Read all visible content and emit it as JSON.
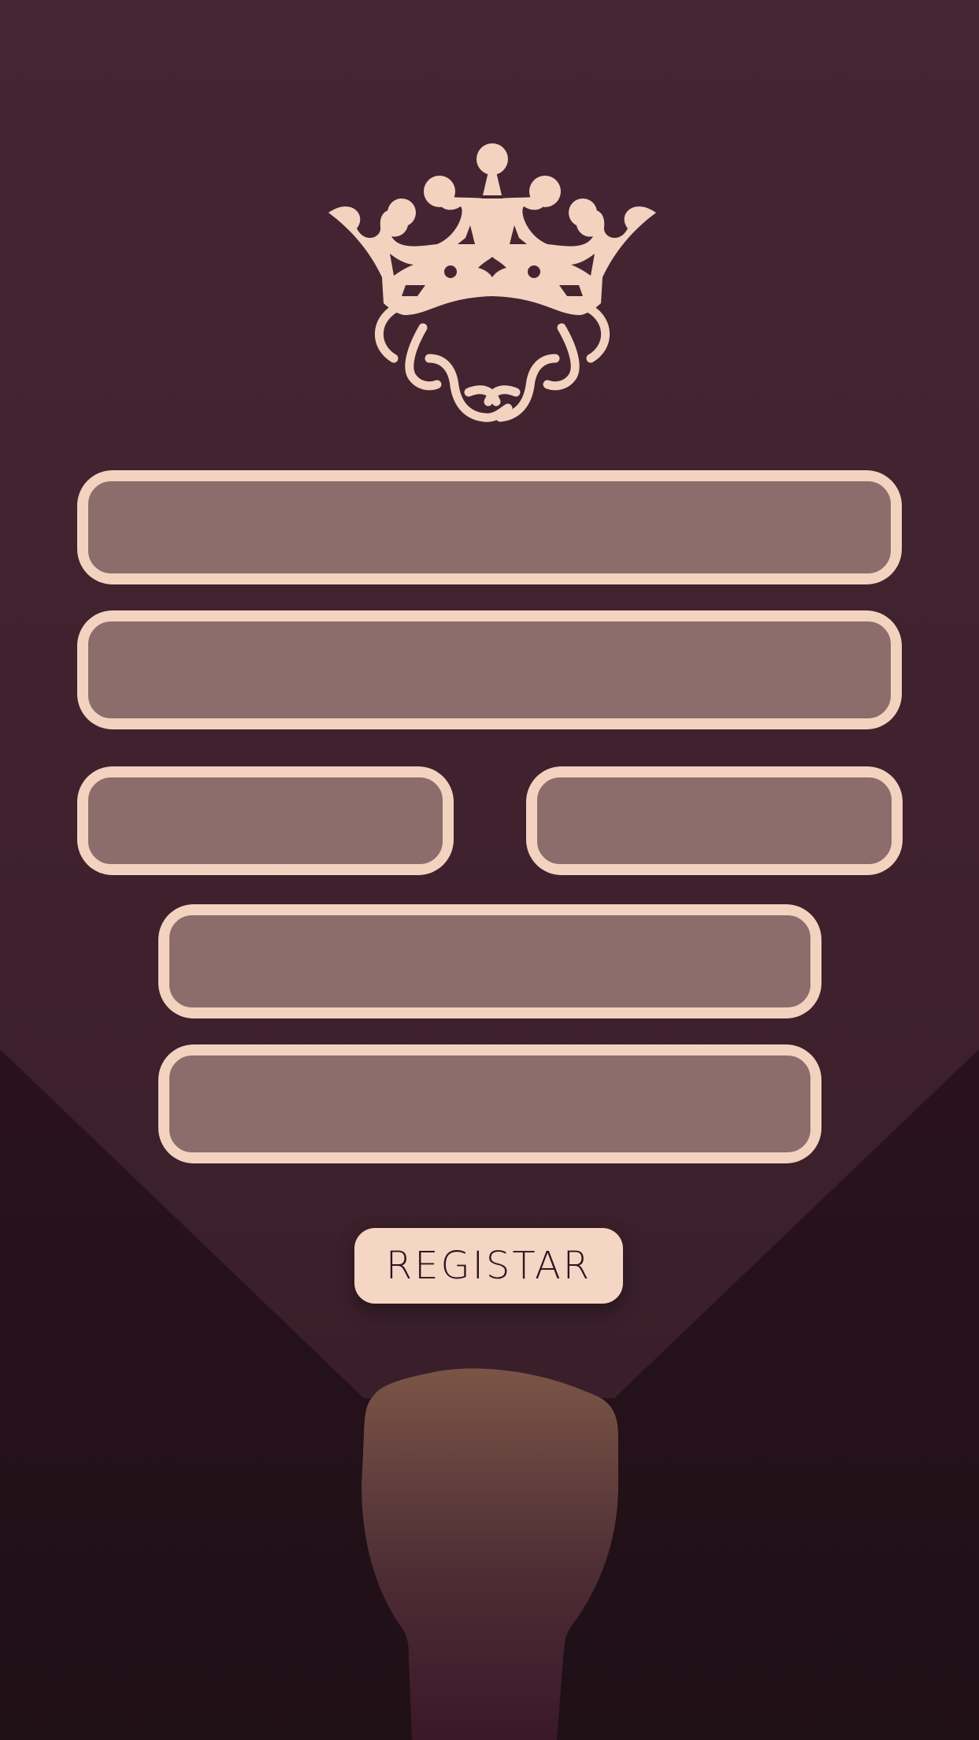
{
  "colors": {
    "background_top": "#462533",
    "background_bottom": "#1f1016",
    "accent": "#f3d3bf",
    "field_fill": "#8c6d6b",
    "button_fill": "#f5d5c3",
    "button_text": "#2a1520"
  },
  "logo": {
    "icon": "crown-wreath-emblem"
  },
  "form": {
    "fields": [
      {
        "value": "",
        "placeholder": ""
      },
      {
        "value": "",
        "placeholder": ""
      },
      {
        "value": "",
        "placeholder": ""
      },
      {
        "value": "",
        "placeholder": ""
      },
      {
        "value": "",
        "placeholder": ""
      },
      {
        "value": "",
        "placeholder": ""
      }
    ],
    "submit_label": "REGISTAR"
  },
  "decoration": {
    "icon": "flashlight-beam"
  }
}
